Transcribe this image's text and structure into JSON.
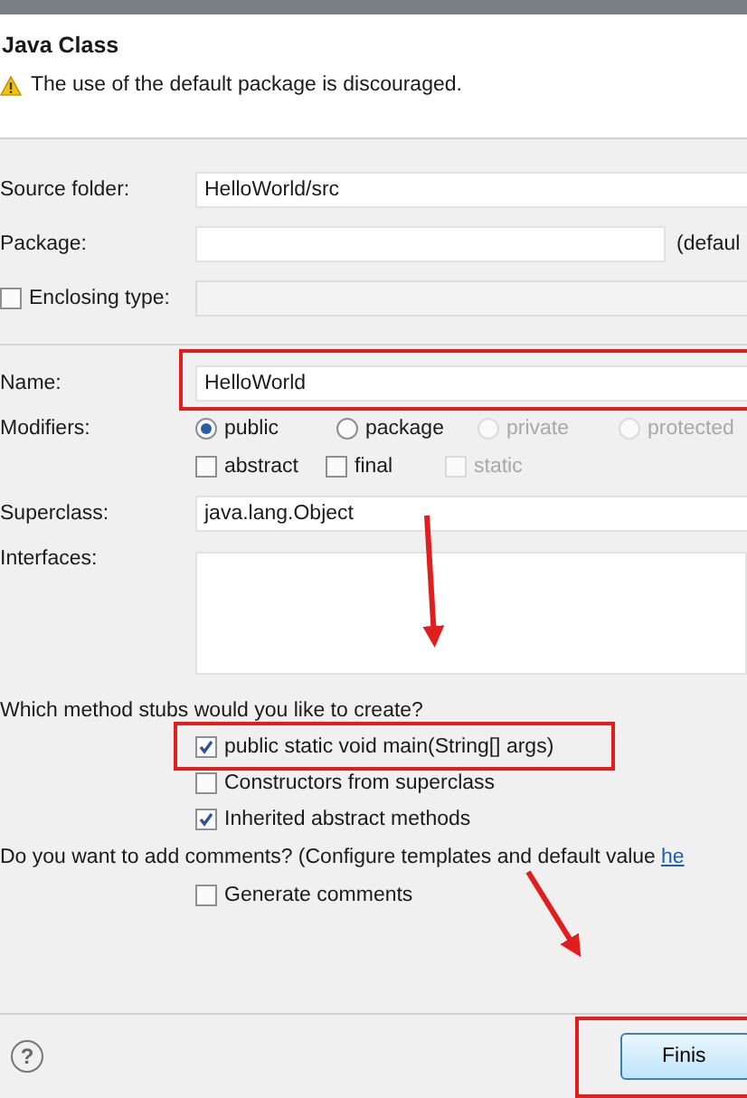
{
  "header": {
    "title": "Java Class",
    "message": "The use of the default package is discouraged."
  },
  "source_folder": {
    "label": "Source folder:",
    "value": "HelloWorld/src"
  },
  "package": {
    "label": "Package:",
    "suffix": "(defaul"
  },
  "enclosing_type": {
    "label": "Enclosing type:",
    "checked": false
  },
  "name": {
    "label": "Name:",
    "value": "HelloWorld"
  },
  "modifiers": {
    "label": "Modifiers:",
    "radios": [
      {
        "label": "public",
        "selected": true,
        "disabled": false
      },
      {
        "label": "package",
        "selected": false,
        "disabled": false
      },
      {
        "label": "private",
        "selected": false,
        "disabled": true
      },
      {
        "label": "protected",
        "selected": false,
        "disabled": true
      }
    ],
    "checkboxes": [
      {
        "label": "abstract",
        "checked": false,
        "disabled": false
      },
      {
        "label": "final",
        "checked": false,
        "disabled": false
      },
      {
        "label": "static",
        "checked": false,
        "disabled": true
      }
    ]
  },
  "superclass": {
    "label": "Superclass:",
    "value": "java.lang.Object"
  },
  "interfaces": {
    "label": "Interfaces:"
  },
  "stubs": {
    "question": "Which method stubs would you like to create?",
    "items": [
      {
        "label": "public static void main(String[] args)",
        "checked": true
      },
      {
        "label": "Constructors from superclass",
        "checked": false
      },
      {
        "label": "Inherited abstract methods",
        "checked": true
      }
    ]
  },
  "comments": {
    "question": "Do you want to add comments? (Configure templates and default value ",
    "link": "he",
    "items": [
      {
        "label": "Generate comments",
        "checked": false
      }
    ]
  },
  "footer": {
    "help": "?",
    "buttons": [
      "Finis"
    ]
  }
}
